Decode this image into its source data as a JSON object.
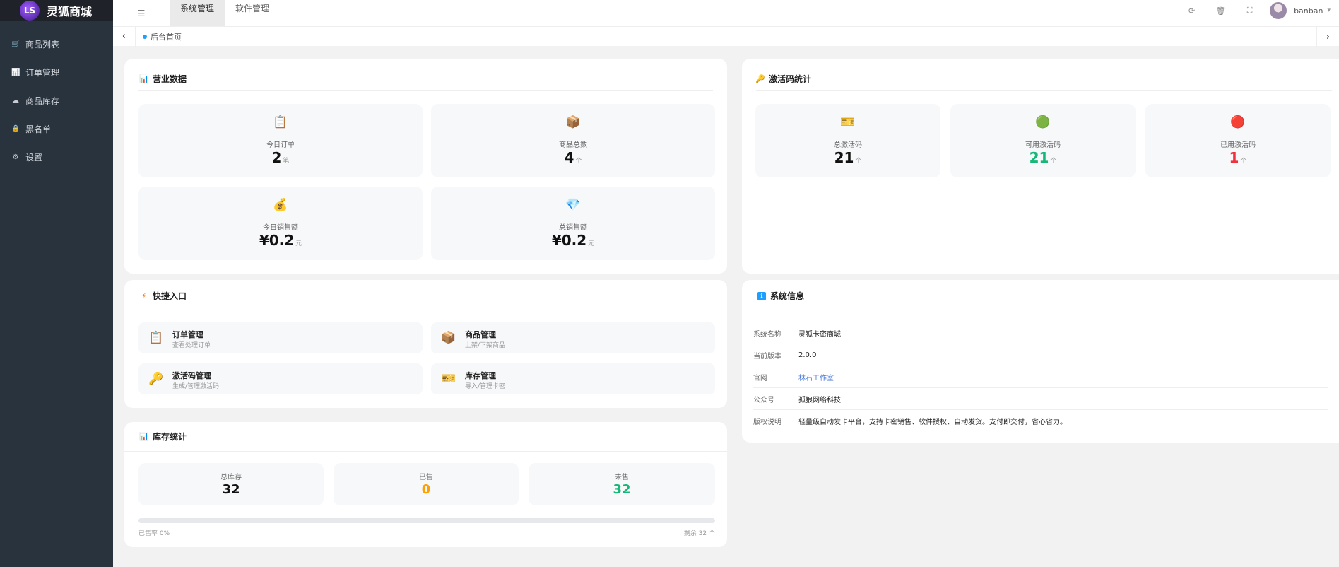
{
  "brand": {
    "name": "灵狐商城",
    "badge": "LS"
  },
  "sidebar": {
    "items": [
      {
        "label": "商品列表",
        "icon": "cart-icon",
        "glyph": "🛒"
      },
      {
        "label": "订单管理",
        "icon": "bar-chart-icon",
        "glyph": "📊"
      },
      {
        "label": "商品库存",
        "icon": "cloud-icon",
        "glyph": "☁"
      },
      {
        "label": "黑名单",
        "icon": "lock-icon",
        "glyph": "🔒"
      },
      {
        "label": "设置",
        "icon": "gear-icon",
        "glyph": "⚙"
      }
    ]
  },
  "topbar": {
    "tabs": [
      "系统管理",
      "软件管理"
    ],
    "active_tab": "系统管理",
    "username": "banban"
  },
  "tabsbar": {
    "current_page": "后台首页"
  },
  "business": {
    "title": "营业数据",
    "stats": [
      {
        "icon": "clipboard-icon",
        "glyph": "📋",
        "label": "今日订单",
        "value": "2",
        "unit": "笔"
      },
      {
        "icon": "package-icon",
        "glyph": "📦",
        "label": "商品总数",
        "value": "4",
        "unit": "个"
      },
      {
        "icon": "money-bag-icon",
        "glyph": "💰",
        "label": "今日销售额",
        "value": "¥0.2",
        "unit": "元"
      },
      {
        "icon": "diamond-icon",
        "glyph": "💎",
        "label": "总销售额",
        "value": "¥0.2",
        "unit": "元"
      }
    ]
  },
  "activation": {
    "title": "激活码统计",
    "stats": [
      {
        "icon": "ticket-icon",
        "glyph": "🎫",
        "label": "总激活码",
        "value": "21",
        "unit": "个",
        "color": "#111111"
      },
      {
        "icon": "green-circle-icon",
        "glyph": "🟢",
        "label": "可用激活码",
        "value": "21",
        "unit": "个",
        "color": "#16b777"
      },
      {
        "icon": "red-circle-icon",
        "glyph": "🔴",
        "label": "已用激活码",
        "value": "1",
        "unit": "个",
        "color": "#f0303f"
      }
    ]
  },
  "quick": {
    "title": "快捷入口",
    "entries": [
      {
        "icon": "clipboard-icon",
        "glyph": "📋",
        "title": "订单管理",
        "sub": "查看处理订单"
      },
      {
        "icon": "package-icon",
        "glyph": "📦",
        "title": "商品管理",
        "sub": "上架/下架商品"
      },
      {
        "icon": "key-icon",
        "glyph": "🔑",
        "title": "激活码管理",
        "sub": "生成/管理激活码"
      },
      {
        "icon": "ticket-icon",
        "glyph": "🎫",
        "title": "库存管理",
        "sub": "导入/管理卡密"
      }
    ]
  },
  "system": {
    "title": "系统信息",
    "rows": [
      {
        "k": "系统名称",
        "v": "灵狐卡密商城"
      },
      {
        "k": "当前版本",
        "v": "2.0.0"
      },
      {
        "k": "官网",
        "v": "林石工作室",
        "link": true
      },
      {
        "k": "公众号",
        "v": "孤狼网络科技"
      },
      {
        "k": "版权说明",
        "v": "轻量级自动发卡平台，支持卡密销售、软件授权、自动发货。支付即交付，省心省力。"
      }
    ]
  },
  "inventory": {
    "title": "库存统计",
    "items": [
      {
        "label": "总库存",
        "value": "32",
        "color": "#111111"
      },
      {
        "label": "已售",
        "value": "0",
        "color": "#ffa000"
      },
      {
        "label": "未售",
        "value": "32",
        "color": "#16b777"
      }
    ],
    "sold_rate_text": "已售率 0%",
    "remaining_text": "剩余 32 个",
    "sold_fraction": 0
  },
  "icons": {
    "menu": "☰",
    "refresh": "⟳",
    "trash": "🗑",
    "fullscreen": "⛶",
    "chevron_left": "‹",
    "chevron_right": "›",
    "caret": "▾",
    "chart_title": "📊",
    "key_title": "🔑",
    "bolt_title": "⚡",
    "info_title": "ℹ"
  }
}
